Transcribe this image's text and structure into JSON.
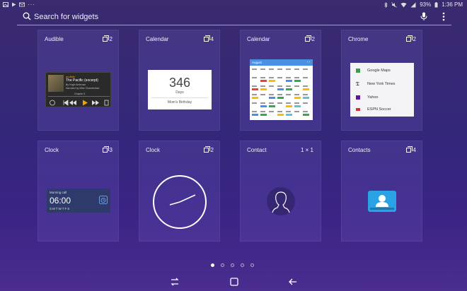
{
  "status_bar": {
    "left_icons": [
      "gallery-icon",
      "play-store-icon",
      "email-icon",
      "more-dots-icon"
    ],
    "battery": "93%",
    "time": "1:36 PM"
  },
  "search": {
    "placeholder": "Search for widgets"
  },
  "widgets": [
    {
      "name": "Audible",
      "count": "2",
      "preview": {
        "app": "audible",
        "title": "The Pacific (excerpt)",
        "author": "By Hugh Ambrose",
        "narrator": "Narrated by Mike Chamberlain",
        "chapter": "Chapter 5"
      }
    },
    {
      "name": "Calendar",
      "count": "4",
      "preview": {
        "number": "346",
        "unit": "Days",
        "event": "Mom's Birthday"
      }
    },
    {
      "name": "Calendar",
      "count": "2",
      "preview": {
        "month": "August"
      }
    },
    {
      "name": "Chrome",
      "count": "2",
      "preview": {
        "bookmarks": [
          "Google Maps",
          "New York Times",
          "Yahoo",
          "ESPN Soccer"
        ]
      }
    },
    {
      "name": "Clock",
      "count": "3",
      "preview": {
        "label": "Morning call",
        "time": "06:00",
        "days": "SMTWTFS"
      }
    },
    {
      "name": "Clock",
      "count": "2"
    },
    {
      "name": "Contact",
      "size": "1 × 1"
    },
    {
      "name": "Contacts",
      "count": "4"
    }
  ],
  "pager": {
    "pages": 5,
    "active": 0
  },
  "nav": [
    "recents-icon",
    "home-icon",
    "back-icon"
  ]
}
